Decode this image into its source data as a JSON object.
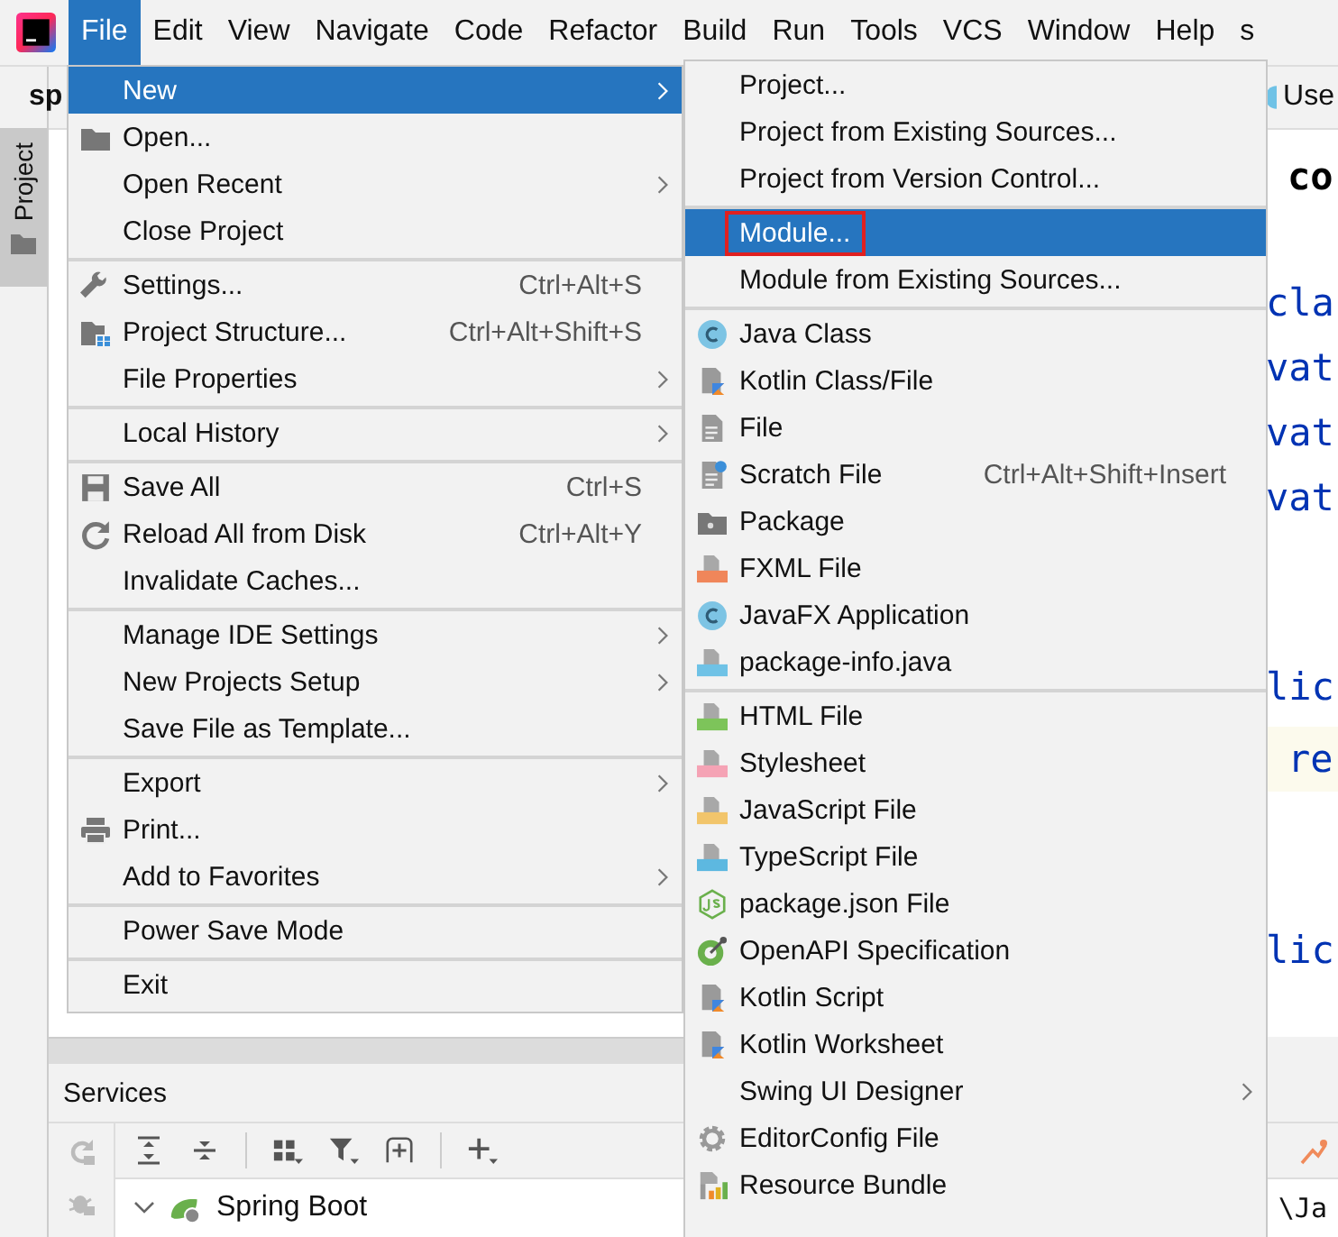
{
  "menu_bar": {
    "items": [
      {
        "label": "File",
        "selected": true
      },
      {
        "label": "Edit",
        "selected": false
      },
      {
        "label": "View",
        "selected": false
      },
      {
        "label": "Navigate",
        "selected": false
      },
      {
        "label": "Code",
        "selected": false
      },
      {
        "label": "Refactor",
        "selected": false
      },
      {
        "label": "Build",
        "selected": false
      },
      {
        "label": "Run",
        "selected": false
      },
      {
        "label": "Tools",
        "selected": false
      },
      {
        "label": "VCS",
        "selected": false
      },
      {
        "label": "Window",
        "selected": false
      },
      {
        "label": "Help",
        "selected": false
      },
      {
        "label": "s",
        "selected": false
      }
    ]
  },
  "tab_bar": {
    "project_name": "sp",
    "right_label": "Use"
  },
  "tool_window_stripe": {
    "label": "Project"
  },
  "editor": {
    "lines": [
      {
        "text": "co",
        "kind": "plain"
      },
      {
        "text": "cla",
        "kind": "keyword"
      },
      {
        "text": "vat",
        "kind": "keyword"
      },
      {
        "text": "vat",
        "kind": "keyword"
      },
      {
        "text": "vat",
        "kind": "keyword"
      },
      {
        "text": "lic",
        "kind": "keyword"
      },
      {
        "text": "re",
        "kind": "current"
      },
      {
        "text": "lic",
        "kind": "keyword"
      }
    ]
  },
  "file_menu": {
    "items": [
      {
        "label": "New",
        "submenu": true,
        "separator_before": false,
        "selected": true
      },
      {
        "label": "Open...",
        "submenu": false,
        "separator_before": false,
        "selected": false
      },
      {
        "label": "Open Recent",
        "submenu": true,
        "separator_before": false,
        "selected": false
      },
      {
        "label": "Close Project",
        "submenu": false,
        "separator_before": false,
        "selected": false
      },
      {
        "label": "Settings...",
        "shortcut": "Ctrl+Alt+S",
        "submenu": false,
        "separator_before": true,
        "selected": false
      },
      {
        "label": "Project Structure...",
        "shortcut": "Ctrl+Alt+Shift+S",
        "submenu": false,
        "separator_before": false,
        "selected": false
      },
      {
        "label": "File Properties",
        "submenu": true,
        "separator_before": false,
        "selected": false
      },
      {
        "label": "Local History",
        "submenu": true,
        "separator_before": true,
        "selected": false
      },
      {
        "label": "Save All",
        "shortcut": "Ctrl+S",
        "submenu": false,
        "separator_before": true,
        "selected": false
      },
      {
        "label": "Reload All from Disk",
        "shortcut": "Ctrl+Alt+Y",
        "submenu": false,
        "separator_before": false,
        "selected": false
      },
      {
        "label": "Invalidate Caches...",
        "submenu": false,
        "separator_before": false,
        "selected": false
      },
      {
        "label": "Manage IDE Settings",
        "submenu": true,
        "separator_before": true,
        "selected": false
      },
      {
        "label": "New Projects Setup",
        "submenu": true,
        "separator_before": false,
        "selected": false
      },
      {
        "label": "Save File as Template...",
        "submenu": false,
        "separator_before": false,
        "selected": false
      },
      {
        "label": "Export",
        "submenu": true,
        "separator_before": true,
        "selected": false
      },
      {
        "label": "Print...",
        "submenu": false,
        "separator_before": false,
        "selected": false
      },
      {
        "label": "Add to Favorites",
        "submenu": true,
        "separator_before": false,
        "selected": false
      },
      {
        "label": "Power Save Mode",
        "submenu": false,
        "separator_before": true,
        "selected": false
      },
      {
        "label": "Exit",
        "submenu": false,
        "separator_before": true,
        "selected": false
      }
    ]
  },
  "new_submenu": {
    "items": [
      {
        "label": "Project...",
        "submenu": false,
        "separator_before": false,
        "selected": false,
        "annotated": false
      },
      {
        "label": "Project from Existing Sources...",
        "submenu": false,
        "separator_before": false,
        "selected": false,
        "annotated": false
      },
      {
        "label": "Project from Version Control...",
        "submenu": false,
        "separator_before": false,
        "selected": false,
        "annotated": false
      },
      {
        "label": "Module...",
        "submenu": false,
        "separator_before": true,
        "selected": true,
        "annotated": true
      },
      {
        "label": "Module from Existing Sources...",
        "submenu": false,
        "separator_before": false,
        "selected": false,
        "annotated": false
      },
      {
        "label": "Java Class",
        "submenu": false,
        "separator_before": true,
        "selected": false,
        "annotated": false
      },
      {
        "label": "Kotlin Class/File",
        "submenu": false,
        "separator_before": false,
        "selected": false,
        "annotated": false
      },
      {
        "label": "File",
        "submenu": false,
        "separator_before": false,
        "selected": false,
        "annotated": false
      },
      {
        "label": "Scratch File",
        "shortcut": "Ctrl+Alt+Shift+Insert",
        "submenu": false,
        "separator_before": false,
        "selected": false,
        "annotated": false
      },
      {
        "label": "Package",
        "submenu": false,
        "separator_before": false,
        "selected": false,
        "annotated": false
      },
      {
        "label": "FXML File",
        "submenu": false,
        "separator_before": false,
        "selected": false,
        "annotated": false
      },
      {
        "label": "JavaFX Application",
        "submenu": false,
        "separator_before": false,
        "selected": false,
        "annotated": false
      },
      {
        "label": "package-info.java",
        "submenu": false,
        "separator_before": false,
        "selected": false,
        "annotated": false
      },
      {
        "label": "HTML File",
        "submenu": false,
        "separator_before": true,
        "selected": false,
        "annotated": false
      },
      {
        "label": "Stylesheet",
        "submenu": false,
        "separator_before": false,
        "selected": false,
        "annotated": false
      },
      {
        "label": "JavaScript File",
        "submenu": false,
        "separator_before": false,
        "selected": false,
        "annotated": false
      },
      {
        "label": "TypeScript File",
        "submenu": false,
        "separator_before": false,
        "selected": false,
        "annotated": false
      },
      {
        "label": "package.json File",
        "submenu": false,
        "separator_before": false,
        "selected": false,
        "annotated": false
      },
      {
        "label": "OpenAPI Specification",
        "submenu": false,
        "separator_before": false,
        "selected": false,
        "annotated": false
      },
      {
        "label": "Kotlin Script",
        "submenu": false,
        "separator_before": false,
        "selected": false,
        "annotated": false
      },
      {
        "label": "Kotlin Worksheet",
        "submenu": false,
        "separator_before": false,
        "selected": false,
        "annotated": false
      },
      {
        "label": "Swing UI Designer",
        "submenu": true,
        "separator_before": false,
        "selected": false,
        "annotated": false
      },
      {
        "label": "EditorConfig File",
        "submenu": false,
        "separator_before": false,
        "selected": false,
        "annotated": false
      },
      {
        "label": "Resource Bundle",
        "submenu": false,
        "separator_before": false,
        "selected": false,
        "annotated": false
      }
    ]
  },
  "services": {
    "title": "Services",
    "tree": [
      {
        "label": "Spring Boot",
        "expanded": true
      }
    ],
    "path_fragment": "\\Ja"
  }
}
